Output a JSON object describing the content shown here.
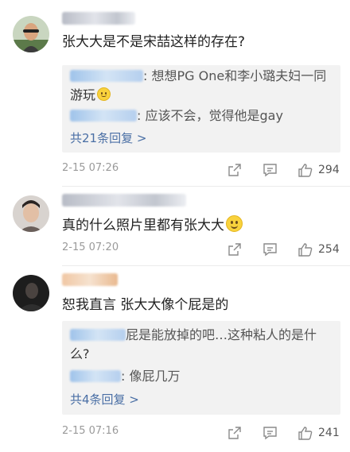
{
  "comments": [
    {
      "text": "张大大是不是宋喆这样的存在?",
      "replies": [
        {
          "text": ": 想想PG One和李小璐夫妇一同",
          "text2": "游玩"
        },
        {
          "text": ": 应该不会，觉得他是gay"
        }
      ],
      "more_replies": "共21条回复 >",
      "timestamp": "2-15 07:26",
      "likes": "294"
    },
    {
      "text": "真的什么照片里都有张大大",
      "timestamp": "2-15 07:20",
      "likes": "254"
    },
    {
      "text": "恕我直言 张大大像个屁是的",
      "replies": [
        {
          "text": "屁是能放掉的吧…这种粘人的是什",
          "text2": "么?"
        },
        {
          "text": ": 像屁几万"
        }
      ],
      "more_replies": "共4条回复 >",
      "timestamp": "2-15 07:16",
      "likes": "241"
    }
  ],
  "icons": {
    "share": "share-icon",
    "comment": "comment-icon",
    "like": "like-icon",
    "emoji": "smile-emoji-icon"
  },
  "colors": {
    "link": "#4a6fa5",
    "reply_bg": "#f2f2f2",
    "meta": "#9a9a9a"
  }
}
